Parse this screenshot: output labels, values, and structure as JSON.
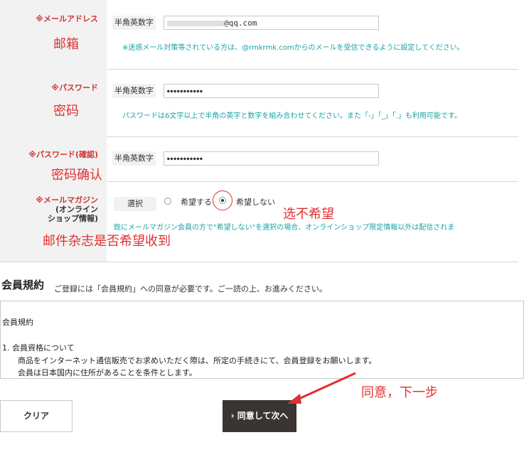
{
  "email": {
    "label": "※メールアドレス",
    "note": "邮箱",
    "field_label": "半角英数字",
    "value": "@qq.com",
    "help": "※迷惑メール対策等されている方は、@rmkrmk.comからのメールを受信できるように設定してください。"
  },
  "password": {
    "label": "※パスワード",
    "note": "密码",
    "field_label": "半角英数字",
    "value": "●●●●●●●●●●●",
    "help": "パスワードは6文字以上で半角の英字と数字を組み合わせてください。また「-」「_」「.」も利用可能です。"
  },
  "password_confirm": {
    "label": "※パスワード(確認)",
    "note": "密码确认",
    "field_label": "半角英数字",
    "value": "●●●●●●●●●●●"
  },
  "magazine": {
    "label_line1": "※メールマガジン",
    "label_line2": "(オンライン",
    "label_line3": "ショップ情報)",
    "note": "邮件杂志是否希望收到",
    "select_label": "選択",
    "option_yes": "希望する",
    "option_no": "希望しない",
    "annotation": "选不希望",
    "help": "既にメールマガジン会員の方で\"希望しない\"を選択の場合、オンラインショップ限定情報以外は配信されま"
  },
  "terms": {
    "title": "会員規約",
    "intro": "ご登録には「会員規約」への同意が必要です。ご一読の上、お進みください。",
    "box_heading": "会員規約",
    "item1_title": "1.  会員資格について",
    "item1_line1": "商品をインターネット通信販売でお求めいただく際は、所定の手続きにて、会員登録をお願いします。",
    "item1_line2": "会員は日本国内に住所があることを条件とします。"
  },
  "buttons": {
    "clear": "クリア",
    "next": "› 同意して次へ",
    "annotation": "同意，下一步"
  },
  "colors": {
    "required": "#d23232",
    "help": "#1aa3a3",
    "annotation": "#e03030",
    "primary_button": "#3a3532"
  }
}
